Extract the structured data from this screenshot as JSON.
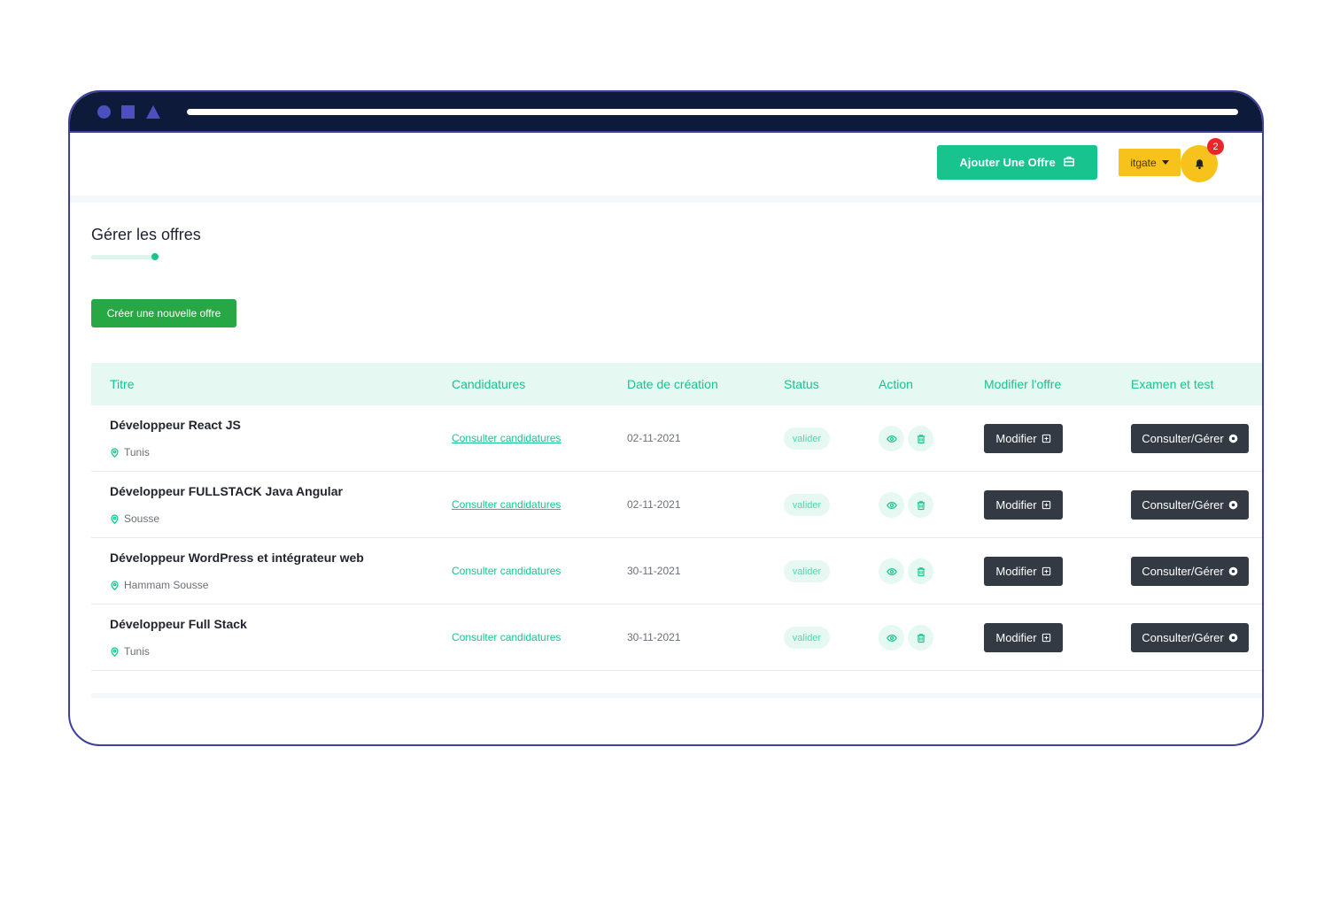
{
  "header": {
    "add_offer_label": "Ajouter Une Offre",
    "user_menu_label": "itgate",
    "notification_count": "2"
  },
  "page": {
    "title": "Gérer les offres",
    "create_button_label": "Créer une nouvelle offre"
  },
  "table": {
    "columns": [
      "Titre",
      "Candidatures",
      "Date de création",
      "Status",
      "Action",
      "Modifier l'offre",
      "Examen et test"
    ],
    "rows": [
      {
        "title": "Développeur React JS",
        "location": "Tunis",
        "applications_link": "Consulter candidatures",
        "date": "02-11-2021",
        "status": "valider",
        "edit_label": "Modifier",
        "manage_label": "Consulter/Gérer"
      },
      {
        "title": "Développeur FULLSTACK Java Angular",
        "location": "Sousse",
        "applications_link": "Consulter candidatures",
        "date": "02-11-2021",
        "status": "valider",
        "edit_label": "Modifier",
        "manage_label": "Consulter/Gérer"
      },
      {
        "title": "Développeur WordPress et intégrateur web",
        "location": "Hammam Sousse",
        "applications_link": "Consulter candidatures",
        "date": "30-11-2021",
        "status": "valider",
        "edit_label": "Modifier",
        "manage_label": "Consulter/Gérer"
      },
      {
        "title": "Développeur Full Stack",
        "location": "Tunis",
        "applications_link": "Consulter candidatures",
        "date": "30-11-2021",
        "status": "valider",
        "edit_label": "Modifier",
        "manage_label": "Consulter/Gérer"
      }
    ]
  },
  "icons": {
    "add_offer": "briefcase-icon",
    "notifications": "bell-icon",
    "location": "map-pin-icon",
    "view": "eye-icon",
    "delete": "trash-icon",
    "edit": "plus-square-icon",
    "manage": "eye-circle-icon"
  },
  "colors": {
    "accent": "#19c38e",
    "create_button": "#27a844",
    "user_button": "#f7c21b",
    "dark_button": "#343a44",
    "badge": "#e8262c",
    "titlebar": "#0e1a3a"
  }
}
